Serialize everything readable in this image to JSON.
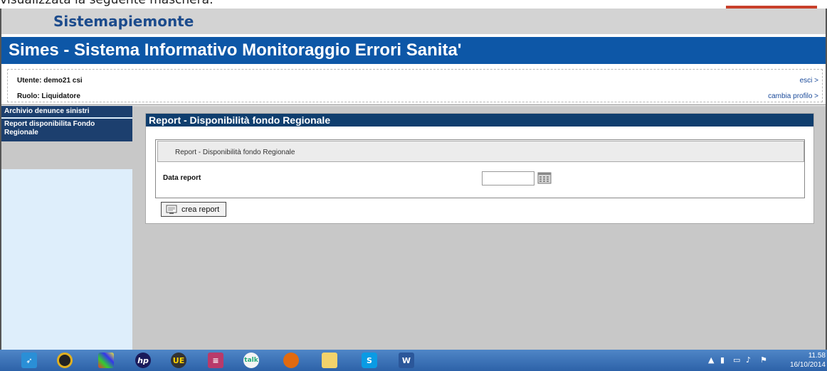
{
  "doc_caption": "visualizzata la seguente maschera:",
  "brand": "Sistemapiemonte",
  "app_title": "Simes - Sistema Informativo Monitoraggio Errori Sanita'",
  "user": {
    "utente_label": "Utente: demo21 csi",
    "ruolo_label": "Ruolo: Liquidatore",
    "logout_link": "esci >",
    "change_profile_link": "cambia profilo >"
  },
  "sidebar": {
    "items": [
      {
        "label": "Archivio denunce sinistri"
      },
      {
        "label": "Report disponibilita Fondo Regionale"
      }
    ]
  },
  "panel": {
    "title": "Report - Disponibilità fondo Regionale",
    "subheader": "Report - Disponibilità fondo Regionale",
    "field_label": "Data report",
    "date_value": "",
    "button_label": "crea report"
  },
  "taskbar": {
    "clock_time": "11.58",
    "clock_date": "16/10/2014",
    "apps": [
      "rocket-icon",
      "media-icon",
      "puzzle-icon",
      "hp-icon",
      "ue-icon",
      "db-icon",
      "talk-icon",
      "firefox-icon",
      "folder-icon",
      "skype-icon",
      "word-icon"
    ]
  },
  "colors": {
    "title_blue": "#0d57a7",
    "nav_dark": "#1c3f6e",
    "panel_head": "#0f3e6e",
    "brand_blue": "#1c4b8c"
  }
}
